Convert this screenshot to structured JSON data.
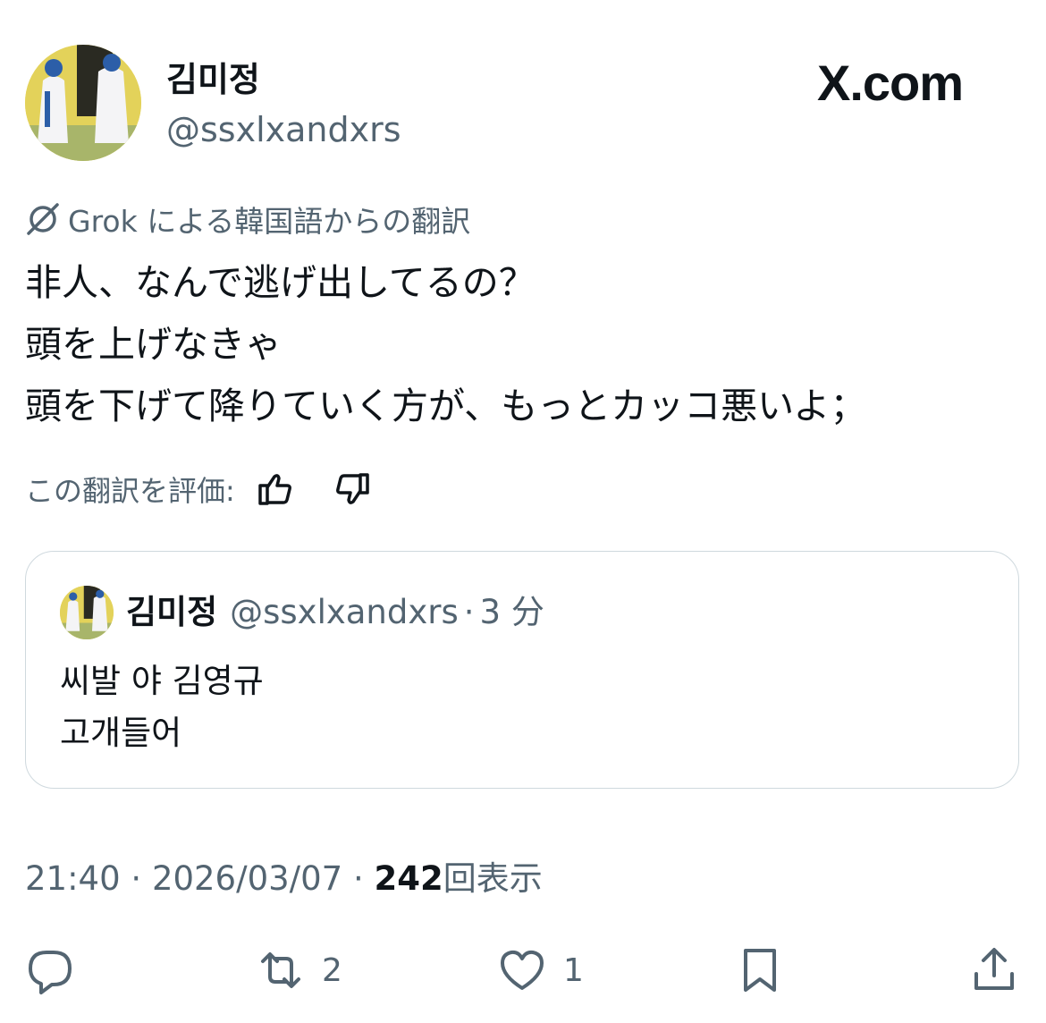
{
  "author": {
    "display_name": "김미정",
    "handle": "@ssxlxandxrs",
    "avatar_icon": "avatar-image"
  },
  "brand": {
    "label": "X.com"
  },
  "translation": {
    "label": "Grok による韓国語からの翻訳",
    "icon": "grok-icon",
    "lines": [
      "非人、なんで逃げ出してるの？",
      "頭を上げなきゃ",
      "頭を下げて降りていく方が、もっとカッコ悪いよ；"
    ],
    "rate_label": "この翻訳を評価:",
    "rate_up_icon": "thumbs-up-icon",
    "rate_down_icon": "thumbs-down-icon"
  },
  "quoted_tweet": {
    "display_name": "김미정",
    "handle": "@ssxlxandxrs",
    "separator": "·",
    "time": "3 分",
    "lines": [
      "씨발 야 김영규",
      "고개들어"
    ]
  },
  "meta": {
    "time": "21:40",
    "date": "2026/03/07",
    "views_count": "242",
    "views_label": "回表示",
    "separator": "·"
  },
  "actions": {
    "reply_icon": "reply-icon",
    "retweet_icon": "retweet-icon",
    "retweet_count": "2",
    "like_icon": "heart-icon",
    "like_count": "1",
    "bookmark_icon": "bookmark-icon",
    "share_icon": "share-icon"
  }
}
